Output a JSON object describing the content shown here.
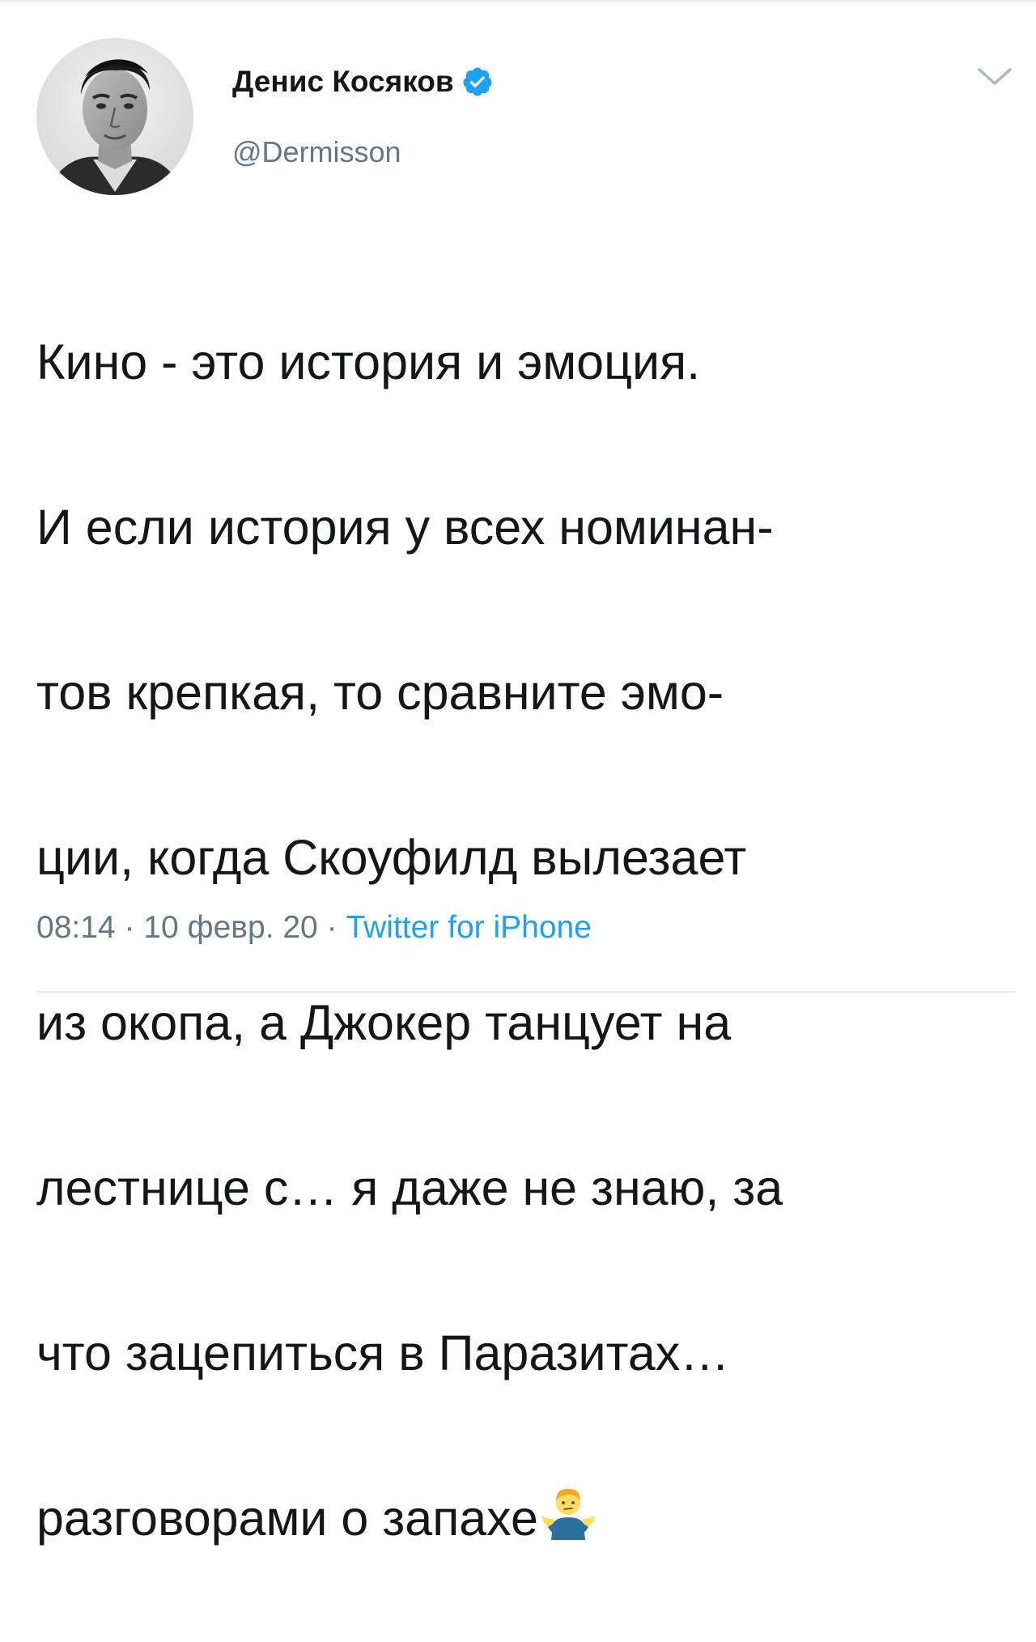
{
  "tweet": {
    "author": {
      "display_name": "Денис Косяков",
      "handle": "@Dermisson",
      "verified": true
    },
    "text_lines": [
      "Кино - это история и эмоция.",
      "И если история у всех номинан-",
      "тов крепкая, то сравните эмо-",
      "ции, когда Скоуфилд вылезает",
      "из окопа, а Джокер танцует на",
      "лестнице с… я даже не знаю, за",
      "что зацепиться в Паразитах…",
      "разговорами о запахе"
    ],
    "trailing_emoji": "person-shrugging-icon",
    "time": "08:14",
    "separator": "·",
    "date": "10 февр. 20",
    "source": "Twitter for iPhone"
  },
  "colors": {
    "text": "#14171a",
    "secondary": "#657786",
    "link": "#1da1f2",
    "verified": "#1da1f2",
    "divider": "#e6ecf0"
  }
}
